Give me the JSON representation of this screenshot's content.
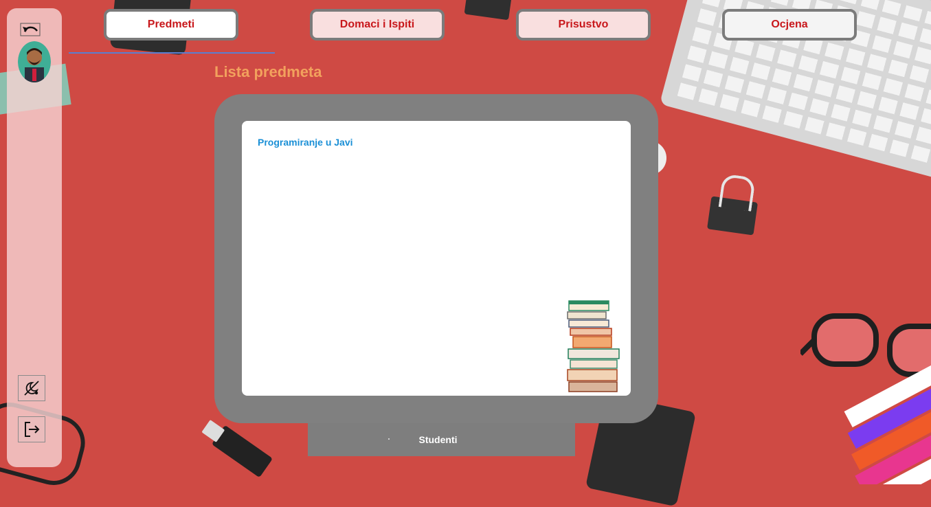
{
  "colors": {
    "background": "#cf4a44",
    "tab_text": "#c8171b",
    "title": "#f2a15d",
    "subject_link": "#1a8fd6"
  },
  "sidebar": {
    "back_icon": "undo-arrow-icon",
    "avatar": "user-avatar",
    "theme_icon": "theme-toggle-icon",
    "logout_icon": "logout-icon"
  },
  "tabs": [
    {
      "label": "Predmeti",
      "active": true
    },
    {
      "label": "Domaci i Ispiti",
      "active": false
    },
    {
      "label": "Prisustvo",
      "active": false
    },
    {
      "label": "Ocjena",
      "active": false
    }
  ],
  "main": {
    "title": "Lista predmeta",
    "subjects": [
      {
        "name": "Programiranje u Javi"
      }
    ]
  },
  "stand": {
    "students_label": "Studenti"
  }
}
